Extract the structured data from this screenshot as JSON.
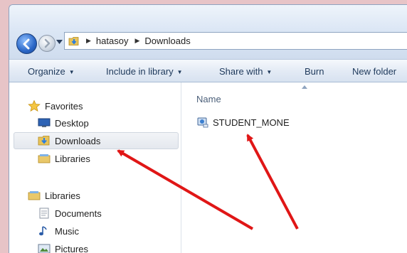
{
  "address": {
    "crumbs": [
      "hatasoy",
      "Downloads"
    ]
  },
  "toolbar": {
    "organize": "Organize",
    "include": "Include in library",
    "share": "Share with",
    "burn": "Burn",
    "new_folder": "New folder"
  },
  "nav": {
    "favorites": "Favorites",
    "desktop": "Desktop",
    "downloads": "Downloads",
    "libraries_fav": "Libraries",
    "libraries": "Libraries",
    "documents": "Documents",
    "music": "Music",
    "pictures": "Pictures"
  },
  "content": {
    "column_name": "Name",
    "file_name": "STUDENT_MONE"
  },
  "colors": {
    "annotation_arrow": "#e01616"
  }
}
